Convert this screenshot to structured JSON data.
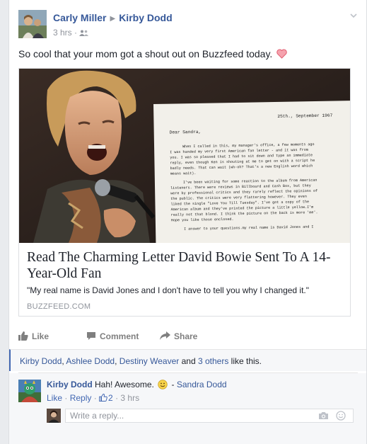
{
  "post": {
    "author": "Carly Miller",
    "recipient": "Kirby Dodd",
    "time": "3 hrs",
    "separator": "·",
    "text": "So cool that your mom got a shout out on Buzzfeed today."
  },
  "link": {
    "title": "Read The Charming Letter David Bowie Sent To A 14-Year-Old Fan",
    "description": "\"My real name is David Jones and I don't have to tell you why I changed it.\"",
    "domain": "BUZZFEED.COM",
    "letter": {
      "date": "25th., September 1967",
      "greeting": "Dear Sandra,",
      "lines": [
        "When I called in this, my manager's office, a few moments ago",
        "I was handed my very first American fan letter - and it was from",
        "you. I was so pleased that I had to sit down and type an immediate",
        "reply, even though Ken is shouting at me to get on with a script he",
        "badly needs.   That can wait (wh-oh? That's a new English word which",
        "means wait).",
        "",
        "I've been waiting for some reaction to the album from American",
        "listeners. There were reviews in Billboard and Cash Box, but they",
        "were by professional critics and they rarely reflect the opinions of",
        "the public. The critics were very flattering however. They even",
        "liked the single \"Love You Till Tuesday\".  I've got a copy of the",
        "American album and they've printed the picture a little yellow.I'm",
        "really not that blond. I think the picture on the back is more 'me'.",
        "Hope you like those enclosed.",
        "",
        "I  answer to your questions.my real name is David Jones and I"
      ]
    }
  },
  "actions": {
    "like": "Like",
    "comment": "Comment",
    "share": "Share"
  },
  "likes": {
    "names": [
      "Kirby Dodd",
      "Ashlee Dodd",
      "Destiny Weaver"
    ],
    "sep": ", ",
    "and": " and ",
    "others": "3 others",
    "suffix": " like this."
  },
  "comment": {
    "author": "Kirby Dodd",
    "text": "Hah! Awesome.",
    "dash": " - ",
    "tag": "Sandra Dodd",
    "like": "Like",
    "dot": " · ",
    "reply": "Reply",
    "like_count": "2",
    "time": "3 hrs"
  },
  "reply_box": {
    "placeholder": "Write a reply..."
  },
  "colors": {
    "link_blue": "#365899",
    "meta_gray": "#90949c",
    "heart": "#f25268"
  }
}
